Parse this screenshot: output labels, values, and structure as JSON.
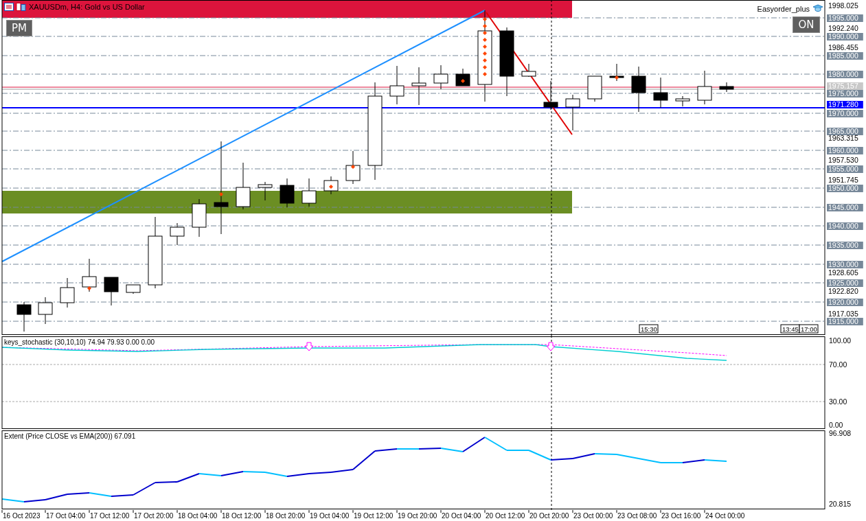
{
  "window": {
    "title": "XAUUSDm, H4:  Gold vs US Dollar"
  },
  "chart_buttons": [
    {
      "kind": "left",
      "label": "PM"
    },
    {
      "kind": "right",
      "label": "ON"
    }
  ],
  "expert": {
    "name": "Easyorder_plus"
  },
  "price_axis": {
    "ticks": [
      "1998.025",
      "1992.240",
      "1986.455",
      "1963.315",
      "1957.530",
      "1951.745",
      "1928.605",
      "1922.820",
      "1917.035"
    ],
    "levels": [
      "1995.000",
      "1990.000",
      "1985.000",
      "1980.000",
      "1975.000",
      "1970.000",
      "1965.000",
      "1960.000",
      "1955.000",
      "1950.000",
      "1945.000",
      "1940.000",
      "1935.000",
      "1930.000",
      "1925.000",
      "1920.000",
      "1915.000"
    ],
    "markers": [
      {
        "label": "1975.157",
        "color": "#c8c8c8"
      },
      {
        "label": "1971.280",
        "color": "#0000ff"
      }
    ]
  },
  "time_markers": [
    "15:30",
    "13:45",
    "17:00"
  ],
  "stochastic": {
    "title": "keys_stochastic (30,10,10) 74.94 79.93 0.00 0.00",
    "axis": [
      "100.00",
      "70.00",
      "30.00",
      "0.00"
    ]
  },
  "extent": {
    "title": "Extent (Price CLOSE vs EMA(200)) 67.091",
    "axis": [
      "96.908",
      "20.815"
    ]
  },
  "time_axis": [
    "16 Oct 2023",
    "17 Oct 04:00",
    "17 Oct 12:00",
    "17 Oct 20:00",
    "18 Oct 04:00",
    "18 Oct 12:00",
    "18 Oct 20:00",
    "19 Oct 04:00",
    "19 Oct 12:00",
    "19 Oct 20:00",
    "20 Oct 04:00",
    "20 Oct 12:00",
    "20 Oct 20:00",
    "23 Oct 00:00",
    "23 Oct 08:00",
    "23 Oct 16:00",
    "24 Oct 00:00"
  ]
}
